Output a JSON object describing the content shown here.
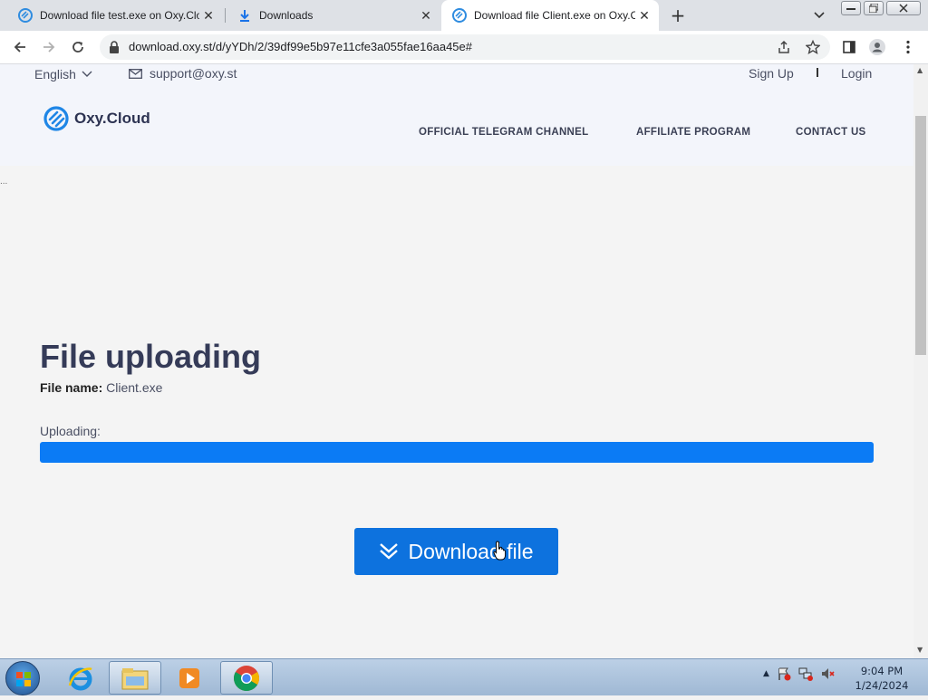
{
  "browser": {
    "tabs": [
      {
        "label": "Download file test.exe on Oxy.Clo",
        "active": false
      },
      {
        "label": "Downloads",
        "active": false
      },
      {
        "label": "Download file Client.exe on Oxy.C",
        "active": true
      }
    ],
    "url": "download.oxy.st/d/yYDh/2/39df99e5b97e11cfe3a055fae16aa45e#",
    "close_glyph": "✕",
    "new_tab_glyph": "+"
  },
  "header": {
    "language": "English",
    "support_email": "support@oxy.st",
    "sign_up": "Sign Up",
    "login": "Login",
    "logo_text": "Oxy.Cloud",
    "nav": [
      {
        "label": "OFFICIAL TELEGRAM CHANNEL"
      },
      {
        "label": "AFFILIATE PROGRAM"
      },
      {
        "label": "CONTACT US"
      }
    ]
  },
  "main": {
    "dots": "...",
    "title": "File uploading",
    "file_name_label": "File name:",
    "file_name": "Client.exe",
    "uploading_label": "Uploading:",
    "progress_fraction": 1.0,
    "download_button": "Download file"
  },
  "taskbar": {
    "time": "9:04 PM",
    "date": "1/24/2024"
  },
  "colors": {
    "accent": "#0d72de",
    "progress": "#0b7bf5",
    "title": "#353b58"
  }
}
